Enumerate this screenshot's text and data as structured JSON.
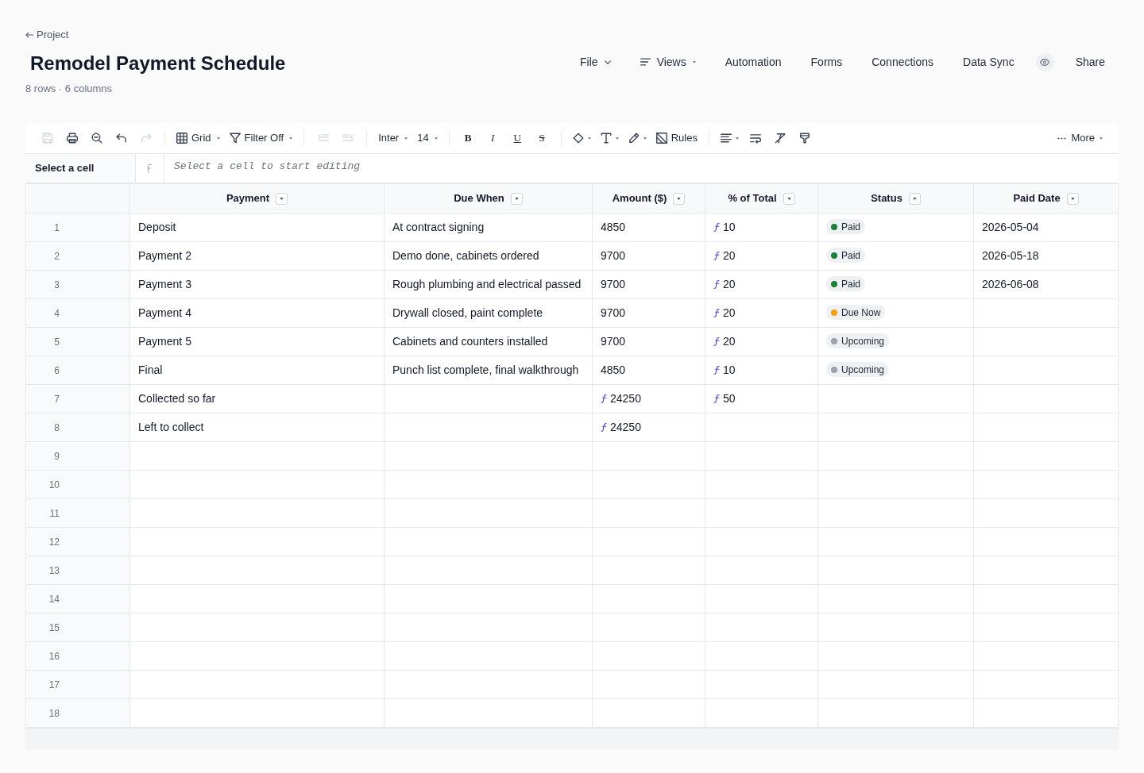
{
  "breadcrumb": {
    "label": "Project"
  },
  "title": "Remodel Payment Schedule",
  "subtitle": "8 rows · 6 columns",
  "nav": [
    {
      "kind": "menu",
      "label": "File"
    },
    {
      "kind": "views",
      "label": "Views"
    },
    {
      "kind": "link",
      "label": "Automation"
    },
    {
      "kind": "link",
      "label": "Forms"
    },
    {
      "kind": "link",
      "label": "Connections"
    },
    {
      "kind": "link",
      "label": "Data Sync"
    },
    {
      "kind": "preview"
    },
    {
      "kind": "link",
      "label": "Share"
    }
  ],
  "toolbar": {
    "groups": [
      [
        {
          "kind": "icon",
          "disabled": true
        },
        {
          "kind": "icon",
          "disabled": false
        },
        {
          "kind": "icon",
          "disabled": false
        },
        {
          "kind": "icon",
          "disabled": false
        },
        {
          "kind": "icon",
          "disabled": true
        }
      ],
      [
        {
          "kind": "dropdown",
          "label": "Grid"
        },
        {
          "kind": "dropdown",
          "label": "Filter Off"
        }
      ],
      [
        {
          "kind": "icon",
          "disabled": true
        },
        {
          "kind": "icon",
          "disabled": true
        }
      ],
      [
        {
          "kind": "select",
          "label": "Inter"
        },
        {
          "kind": "select",
          "label": "14"
        }
      ],
      [
        {
          "kind": "bold",
          "label": "B"
        },
        {
          "kind": "italic",
          "label": "I"
        },
        {
          "kind": "underline",
          "label": "U"
        },
        {
          "kind": "strike",
          "label": "S"
        }
      ],
      [
        {
          "kind": "menu"
        },
        {
          "kind": "menu"
        },
        {
          "kind": "menu"
        },
        {
          "kind": "button",
          "label": "Rules"
        }
      ],
      [
        {
          "kind": "menu"
        },
        {
          "kind": "icon",
          "disabled": false
        },
        {
          "kind": "icon",
          "disabled": false
        },
        {
          "kind": "icon",
          "disabled": false
        }
      ]
    ],
    "more": {
      "label": "More"
    }
  },
  "formula_bar": {
    "cell_ref": "Select a cell",
    "placeholder": "Select a cell to start editing"
  },
  "table": {
    "columns": [
      {
        "label": "Payment"
      },
      {
        "label": "Due When"
      },
      {
        "label": "Amount ($)"
      },
      {
        "label": "% of Total"
      },
      {
        "label": "Status"
      },
      {
        "label": "Paid Date"
      }
    ],
    "rows": [
      {
        "number": "1",
        "cells": [
          {
            "kind": "text",
            "text": "Deposit"
          },
          {
            "kind": "text",
            "text": "At contract signing"
          },
          {
            "kind": "text",
            "text": "4850"
          },
          {
            "kind": "formula",
            "text": "10"
          },
          {
            "kind": "status",
            "label": "Paid",
            "color": "#1a7f37"
          },
          {
            "kind": "text",
            "text": "2026-05-04"
          }
        ]
      },
      {
        "number": "2",
        "cells": [
          {
            "kind": "text",
            "text": "Payment 2"
          },
          {
            "kind": "text",
            "text": "Demo done, cabinets ordered"
          },
          {
            "kind": "text",
            "text": "9700"
          },
          {
            "kind": "formula",
            "text": "20"
          },
          {
            "kind": "status",
            "label": "Paid",
            "color": "#1a7f37"
          },
          {
            "kind": "text",
            "text": "2026-05-18"
          }
        ]
      },
      {
        "number": "3",
        "cells": [
          {
            "kind": "text",
            "text": "Payment 3"
          },
          {
            "kind": "text",
            "text": "Rough plumbing and electrical passed"
          },
          {
            "kind": "text",
            "text": "9700"
          },
          {
            "kind": "formula",
            "text": "20"
          },
          {
            "kind": "status",
            "label": "Paid",
            "color": "#1a7f37"
          },
          {
            "kind": "text",
            "text": "2026-06-08"
          }
        ]
      },
      {
        "number": "4",
        "cells": [
          {
            "kind": "text",
            "text": "Payment 4"
          },
          {
            "kind": "text",
            "text": "Drywall closed, paint complete"
          },
          {
            "kind": "text",
            "text": "9700"
          },
          {
            "kind": "formula",
            "text": "20"
          },
          {
            "kind": "status",
            "label": "Due Now",
            "color": "#f59e0b"
          },
          null
        ]
      },
      {
        "number": "5",
        "cells": [
          {
            "kind": "text",
            "text": "Payment 5"
          },
          {
            "kind": "text",
            "text": "Cabinets and counters installed"
          },
          {
            "kind": "text",
            "text": "9700"
          },
          {
            "kind": "formula",
            "text": "20"
          },
          {
            "kind": "status",
            "label": "Upcoming",
            "color": "#9ca3af"
          },
          null
        ]
      },
      {
        "number": "6",
        "cells": [
          {
            "kind": "text",
            "text": "Final"
          },
          {
            "kind": "text",
            "text": "Punch list complete, final walkthrough"
          },
          {
            "kind": "text",
            "text": "4850"
          },
          {
            "kind": "formula",
            "text": "10"
          },
          {
            "kind": "status",
            "label": "Upcoming",
            "color": "#9ca3af"
          },
          null
        ]
      },
      {
        "number": "7",
        "cells": [
          {
            "kind": "text",
            "text": "Collected so far"
          },
          null,
          {
            "kind": "formula",
            "text": "24250"
          },
          {
            "kind": "formula",
            "text": "50"
          },
          null,
          null
        ]
      },
      {
        "number": "8",
        "cells": [
          {
            "kind": "text",
            "text": "Left to collect"
          },
          null,
          {
            "kind": "formula",
            "text": "24250"
          },
          null,
          null,
          null
        ]
      }
    ],
    "empty_rows": [
      "9",
      "10",
      "11",
      "12",
      "13",
      "14",
      "15",
      "16",
      "17",
      "18"
    ]
  }
}
